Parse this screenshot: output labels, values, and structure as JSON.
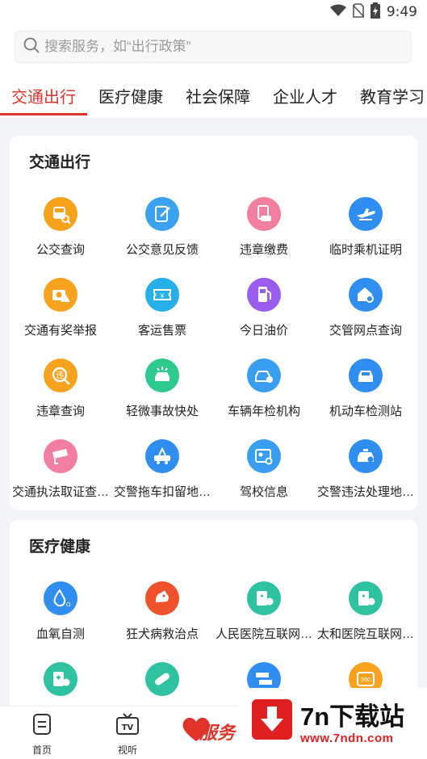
{
  "status": {
    "time": "9:49"
  },
  "search": {
    "placeholder": "搜索服务，如“出行政策”"
  },
  "tabs": [
    "交通出行",
    "医疗健康",
    "社会保障",
    "企业人才",
    "教育学习"
  ],
  "sections": [
    {
      "title": "交通出行",
      "items": [
        {
          "label": "公交查询",
          "icon": "bus-search-icon",
          "color": "#f6a21b"
        },
        {
          "label": "公交意见反馈",
          "icon": "edit-note-icon",
          "color": "#3aa2ee"
        },
        {
          "label": "违章缴费",
          "icon": "car-fine-icon",
          "color": "#f27fa0"
        },
        {
          "label": "临时乘机证明",
          "icon": "airplane-icon",
          "color": "#2f8ef0"
        },
        {
          "label": "交通有奖举报",
          "icon": "camera-warning-icon",
          "color": "#f8a31e"
        },
        {
          "label": "客运售票",
          "icon": "ticket-icon",
          "color": "#27b0e8"
        },
        {
          "label": "今日油价",
          "icon": "fuel-pump-icon",
          "color": "#9b5cf0"
        },
        {
          "label": "交管网点查询",
          "icon": "office-search-icon",
          "color": "#2f8ef0"
        },
        {
          "label": "违章查询",
          "icon": "violation-search-icon",
          "color": "#f8a31e"
        },
        {
          "label": "轻微事故快处",
          "icon": "car-accident-icon",
          "color": "#2ec98c"
        },
        {
          "label": "车辆年检机构",
          "icon": "car-inspection-icon",
          "color": "#3a9ef0"
        },
        {
          "label": "机动车检测站",
          "icon": "car-front-icon",
          "color": "#2f8ef0"
        },
        {
          "label": "交通执法取证查…",
          "icon": "cctv-camera-icon",
          "color": "#f27fa0"
        },
        {
          "label": "交警拖车扣留地…",
          "icon": "tow-truck-icon",
          "color": "#2f8ef0"
        },
        {
          "label": "驾校信息",
          "icon": "id-card-search-icon",
          "color": "#3a9ef0"
        },
        {
          "label": "交警违法处理地…",
          "icon": "police-car-icon",
          "color": "#2f8ef0"
        }
      ]
    },
    {
      "title": "医疗健康",
      "items": [
        {
          "label": "血氧自测",
          "icon": "oxygen-drop-icon",
          "color": "#2f8ef0"
        },
        {
          "label": "狂犬病救治点",
          "icon": "dog-icon",
          "color": "#f0512d"
        },
        {
          "label": "人民医院互联网…",
          "icon": "hospital-person-icon",
          "color": "#2ec2a0"
        },
        {
          "label": "太和医院互联网…",
          "icon": "hospital-building-icon",
          "color": "#2ec2a0"
        },
        {
          "label": "",
          "icon": "hospital-clinic-icon",
          "color": "#2ec2a0"
        },
        {
          "label": "",
          "icon": "medicine-pill-icon",
          "color": "#2ec2a0"
        },
        {
          "label": "",
          "icon": "directions-sign-icon",
          "color": "#2f8ef0"
        },
        {
          "label": "",
          "icon": "panorama-360-icon",
          "color": "#f8a31e"
        }
      ]
    }
  ],
  "bottom_nav": [
    {
      "label": "首页",
      "icon": "home-doc-icon"
    },
    {
      "label": "视听",
      "icon": "tv-icon"
    }
  ],
  "watermark": {
    "title": "7n下载站",
    "url": "www.7ndn.com"
  },
  "fav_mark": "服务"
}
